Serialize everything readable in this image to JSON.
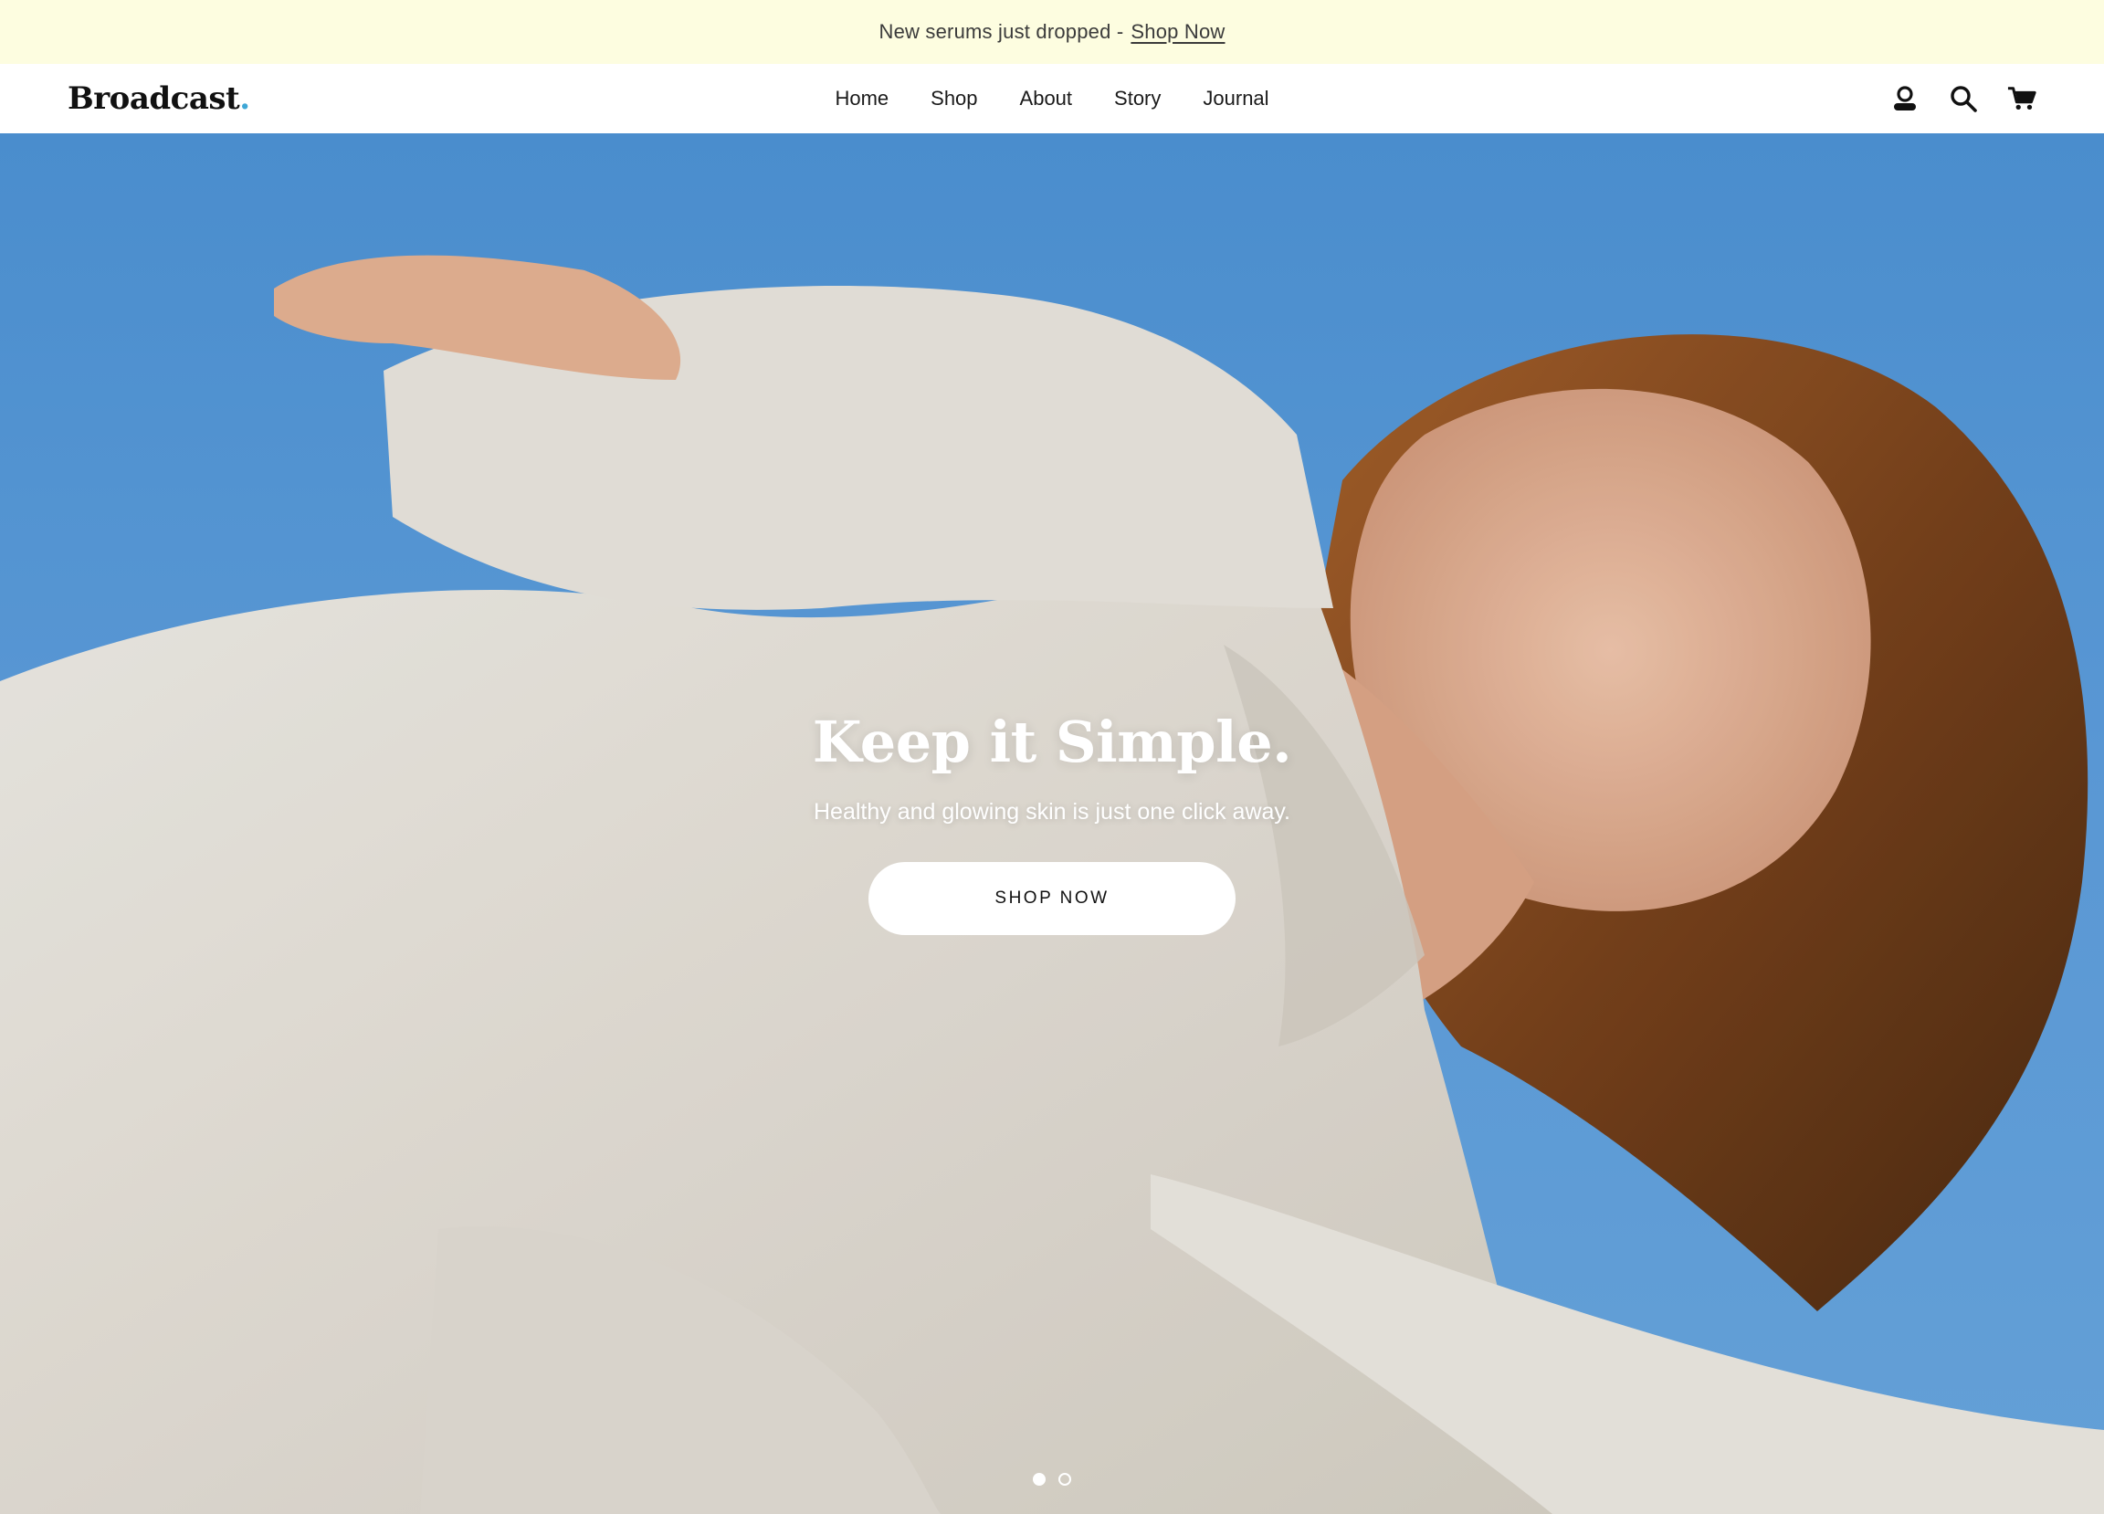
{
  "announcement": {
    "text": "New serums just dropped -",
    "link_label": "Shop Now"
  },
  "header": {
    "logo_text": "Broadcast",
    "logo_dot": ".",
    "nav": [
      {
        "label": "Home"
      },
      {
        "label": "Shop"
      },
      {
        "label": "About"
      },
      {
        "label": "Story"
      },
      {
        "label": "Journal"
      }
    ],
    "icons": [
      "account-icon",
      "search-icon",
      "cart-icon"
    ]
  },
  "hero": {
    "title": "Keep it Simple.",
    "subtitle": "Healthy and glowing skin is just one click away.",
    "cta_label": "SHOP NOW",
    "slides_count": 2,
    "active_slide": 1
  },
  "colors": {
    "announcement_bg": "#fdfde0",
    "logo_accent": "#3ea7d6",
    "sky": "#5ea0e0"
  }
}
